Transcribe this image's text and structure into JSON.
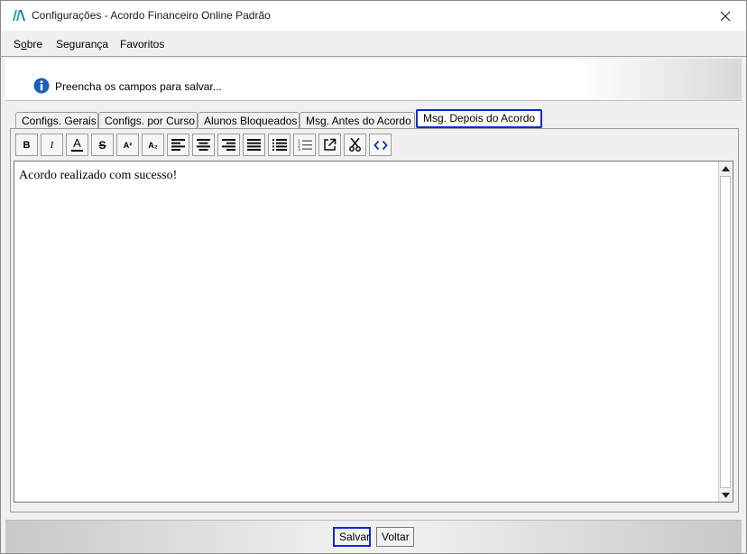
{
  "window": {
    "title": "Configurações - Acordo Financeiro Online Padrão"
  },
  "menu": {
    "items": [
      {
        "label": "Sobre",
        "mnemonic": "o"
      },
      {
        "label": "Segurança"
      },
      {
        "label": "Favoritos"
      }
    ]
  },
  "info": {
    "message": "Preencha os campos para salvar..."
  },
  "tabs": [
    {
      "label": "Configs. Gerais"
    },
    {
      "label": "Configs. por Curso"
    },
    {
      "label": "Alunos Bloqueados"
    },
    {
      "label": "Msg. Antes do Acordo"
    },
    {
      "label": "Msg. Depois do Acordo",
      "active": true
    }
  ],
  "toolbar": {
    "buttons": [
      "bold-icon",
      "italic-icon",
      "font-color-icon",
      "strikethrough-icon",
      "superscript-icon",
      "subscript-icon",
      "align-left-icon",
      "align-center-icon",
      "align-right-icon",
      "align-justify-icon",
      "bullet-list-icon",
      "numbered-list-icon",
      "external-link-icon",
      "scissors-icon",
      "code-icon"
    ],
    "bold_glyph": "B",
    "italic_glyph": "I",
    "font_color_glyph": "A",
    "strike_glyph": "S",
    "super_glyph": "A²",
    "sub_glyph": "A₂"
  },
  "editor": {
    "content": "Acordo realizado com sucesso!"
  },
  "footer": {
    "save_label": "Salvar",
    "back_label": "Voltar"
  },
  "colors": {
    "active_tab_border": "#0a2ad6",
    "info_icon": "#1d5fbf",
    "app_icon": "#2aa39a"
  }
}
